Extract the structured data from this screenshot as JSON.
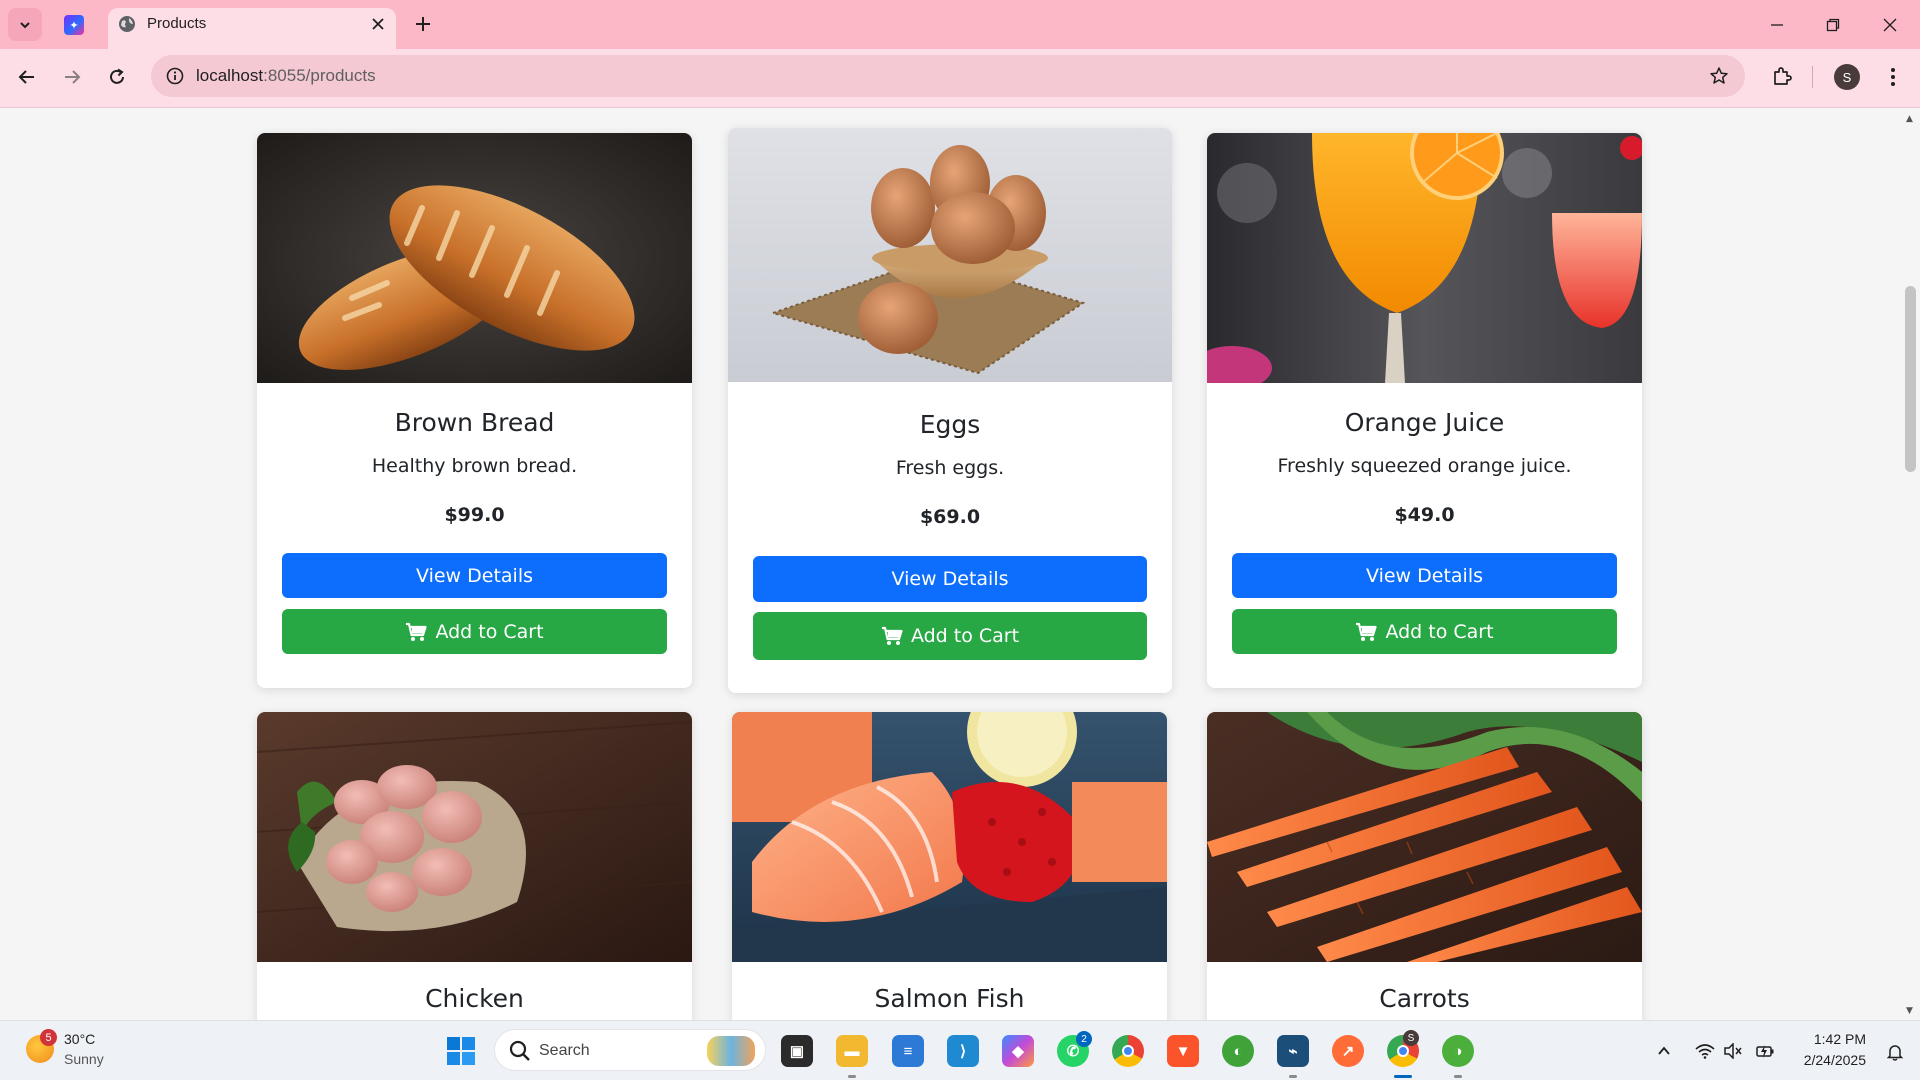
{
  "browser": {
    "tab_title": "Products",
    "url_host": "localhost",
    "url_path": ":8055/products",
    "profile_initial": "S"
  },
  "products": [
    {
      "name": "Brown Bread",
      "description": "Healthy brown bread.",
      "price": "$99.0",
      "view_label": "View Details",
      "cart_label": "Add to Cart",
      "image": "bread-photo"
    },
    {
      "name": "Eggs",
      "description": "Fresh eggs.",
      "price": "$69.0",
      "view_label": "View Details",
      "cart_label": "Add to Cart",
      "image": "eggs-photo"
    },
    {
      "name": "Orange Juice",
      "description": "Freshly squeezed orange juice.",
      "price": "$49.0",
      "view_label": "View Details",
      "cart_label": "Add to Cart",
      "image": "orange-juice-photo"
    },
    {
      "name": "Chicken",
      "image": "chicken-photo"
    },
    {
      "name": "Salmon Fish",
      "image": "salmon-photo"
    },
    {
      "name": "Carrots",
      "image": "carrots-photo"
    }
  ],
  "colors": {
    "primary": "#0d6efd",
    "success": "#28a745",
    "tabbar": "#fdb8c8",
    "toolbar": "#fddde6"
  },
  "taskbar": {
    "weather_temp": "30°C",
    "weather_condition": "Sunny",
    "weather_badge": "5",
    "search_placeholder": "Search",
    "whatsapp_badge": "2",
    "chrome_profile_badge": "S",
    "time": "1:42 PM",
    "date": "2/24/2025"
  }
}
